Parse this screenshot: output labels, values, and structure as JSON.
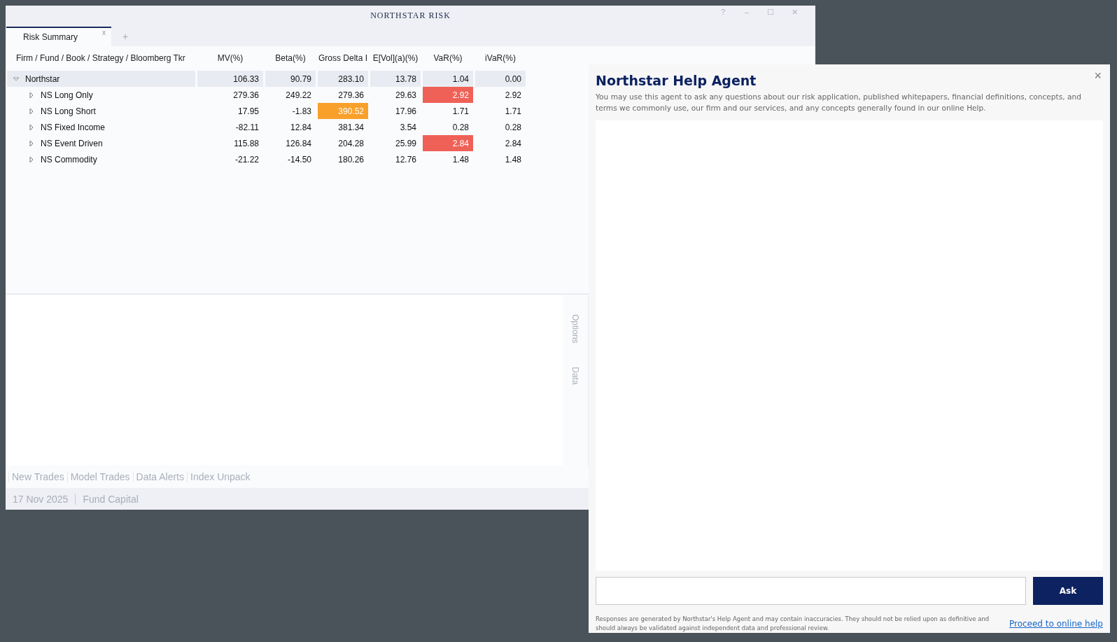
{
  "window": {
    "title": "NORTHSTAR RISK",
    "controls": [
      "?",
      "–",
      "☐",
      "✕"
    ]
  },
  "tabs": [
    {
      "label": "Risk Summary",
      "selected": true,
      "close": "x"
    }
  ],
  "new_tab": "+",
  "table": {
    "tree_header": "Firm / Fund / Book / Strategy / Bloomberg Tkr",
    "columns": [
      "MV(%)",
      "Beta(%)",
      "Gross Delta I",
      "E[Vol](a)(%)",
      "VaR(%)",
      "iVaR(%)"
    ],
    "rows": [
      {
        "name": "Northstar",
        "expanded": true,
        "cells": [
          {
            "value": "106.33"
          },
          {
            "value": "90.79"
          },
          {
            "value": "283.10"
          },
          {
            "value": "13.78"
          },
          {
            "value": "1.04"
          },
          {
            "value": "0.00"
          }
        ],
        "children": [
          {
            "name": "NS Long Only",
            "expanded": false,
            "cells": [
              {
                "value": "279.36"
              },
              {
                "value": "249.22"
              },
              {
                "value": "279.36"
              },
              {
                "value": "29.63"
              },
              {
                "value": "2.92",
                "color": "#ef6157"
              },
              {
                "value": "2.92"
              }
            ]
          },
          {
            "name": "NS Long Short",
            "expanded": false,
            "cells": [
              {
                "value": "17.95"
              },
              {
                "value": "-1.83"
              },
              {
                "value": "390.52",
                "color": "#f9a02a"
              },
              {
                "value": "17.96"
              },
              {
                "value": "1.71"
              },
              {
                "value": "1.71"
              }
            ]
          },
          {
            "name": "NS Fixed Income",
            "expanded": false,
            "cells": [
              {
                "value": "-82.11"
              },
              {
                "value": "12.84"
              },
              {
                "value": "381.34"
              },
              {
                "value": "3.54"
              },
              {
                "value": "0.28"
              },
              {
                "value": "0.28"
              }
            ]
          },
          {
            "name": "NS Event Driven",
            "expanded": false,
            "cells": [
              {
                "value": "115.88"
              },
              {
                "value": "126.84"
              },
              {
                "value": "204.28"
              },
              {
                "value": "25.99"
              },
              {
                "value": "2.84",
                "color": "#ef6157"
              },
              {
                "value": "2.84"
              }
            ]
          },
          {
            "name": "NS Commodity",
            "expanded": false,
            "cells": [
              {
                "value": "-21.22"
              },
              {
                "value": "-14.50"
              },
              {
                "value": "180.26"
              },
              {
                "value": "12.76"
              },
              {
                "value": "1.48"
              },
              {
                "value": "1.48"
              }
            ]
          }
        ]
      }
    ]
  },
  "side_tabs": [
    "Options",
    "Data"
  ],
  "bottom_links": [
    "New Trades",
    "Model Trades",
    "Data Alerts",
    "Index Unpack"
  ],
  "status_bar": [
    "17 Nov 2025",
    "Fund Capital"
  ],
  "help_agent": {
    "title": "Northstar Help Agent",
    "description": "You may use this agent to ask any questions about our risk application, published whitepapers, financial definitions, concepts, and terms we commonly use, our firm and our services, and any concepts generally found in our online Help.",
    "close": "×",
    "ask_button": "Ask",
    "disclaimer": "Responses are generated by Northstar's Help Agent and may contain inaccuracies. They should not be relied upon as definitive and should always be validated against independent data and professional review.",
    "link": "Proceed to online help"
  }
}
